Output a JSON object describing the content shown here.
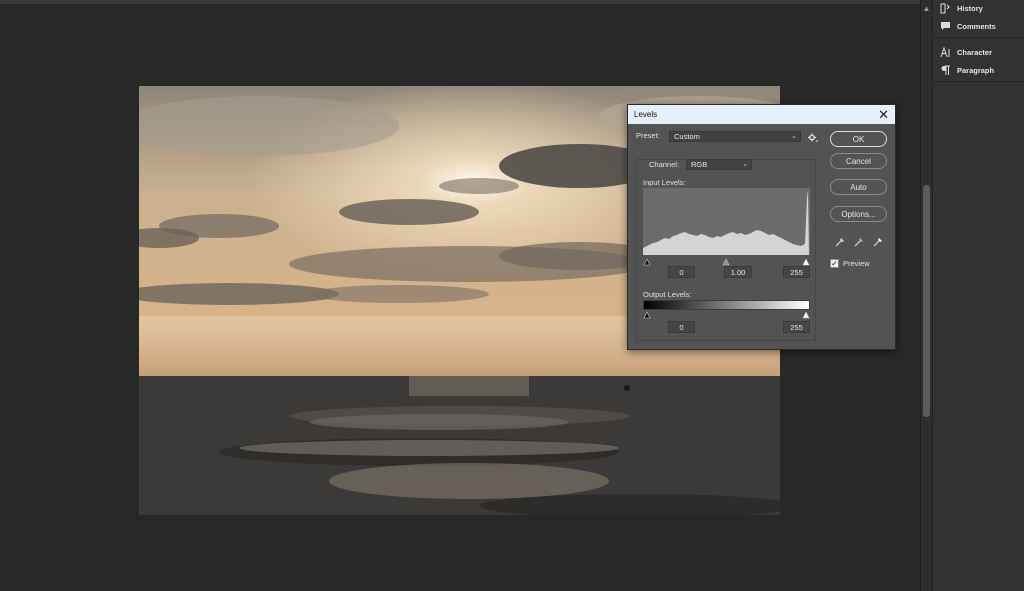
{
  "right_panel": {
    "items": [
      {
        "label": "History",
        "icon": "history-icon"
      },
      {
        "label": "Comments",
        "icon": "comments-icon"
      },
      {
        "label": "Character",
        "icon": "character-icon"
      },
      {
        "label": "Paragraph",
        "icon": "paragraph-icon"
      }
    ]
  },
  "dialog": {
    "title": "Levels",
    "close_glyph": "✕",
    "preset_label": "Preset:",
    "preset_value": "Custom",
    "channel_label": "Channel:",
    "channel_value": "RGB",
    "input_levels_label": "Input Levels:",
    "input_black": "0",
    "input_gamma": "1.00",
    "input_white": "255",
    "output_levels_label": "Output Levels:",
    "output_black": "0",
    "output_white": "255",
    "buttons": {
      "ok": "OK",
      "cancel": "Cancel",
      "auto": "Auto",
      "options": "Options..."
    },
    "preview_label": "Preview",
    "preview_checked": true
  },
  "colors": {
    "dialog_bg": "#535353",
    "titlebar_bg": "#e6f0fa",
    "canvas_bg": "#282828"
  }
}
